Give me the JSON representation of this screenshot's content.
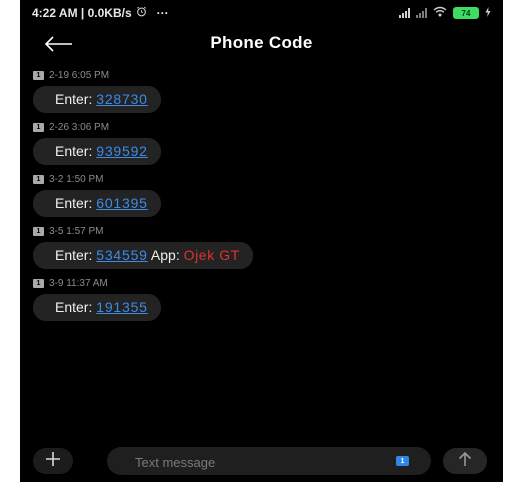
{
  "status_bar": {
    "time_and_speed": "4:22 AM | 0.0KB/s",
    "more": "···",
    "battery_level": "74"
  },
  "header": {
    "title": "Phone Code"
  },
  "messages": [
    {
      "sim": "1",
      "timestamp": "2-19 6:05 PM",
      "prefix": "Enter:",
      "code": "328730"
    },
    {
      "sim": "1",
      "timestamp": "2-26 3:06 PM",
      "prefix": "Enter:",
      "code": "939592"
    },
    {
      "sim": "1",
      "timestamp": "3-2 1:50 PM",
      "prefix": "Enter:",
      "code": "601395"
    },
    {
      "sim": "1",
      "timestamp": "3-5 1:57 PM",
      "prefix": "Enter:",
      "code": "534559",
      "app_label": "App:",
      "app_name": "Ojek GT"
    },
    {
      "sim": "1",
      "timestamp": "3-9 11:37 AM",
      "prefix": "Enter:",
      "code": "191355"
    }
  ],
  "composer": {
    "placeholder": "Text message",
    "sim_selected": "1"
  },
  "colors": {
    "background": "#000000",
    "bubble": "#232323",
    "link": "#3d8be8",
    "app_name": "#e0322f",
    "battery": "#3ddc63"
  },
  "icons": {
    "back": "arrow-left",
    "attach": "plus",
    "send": "arrow-up",
    "wifi": "wifi",
    "signal": "cell-signal",
    "alarm": "alarm-clock"
  }
}
